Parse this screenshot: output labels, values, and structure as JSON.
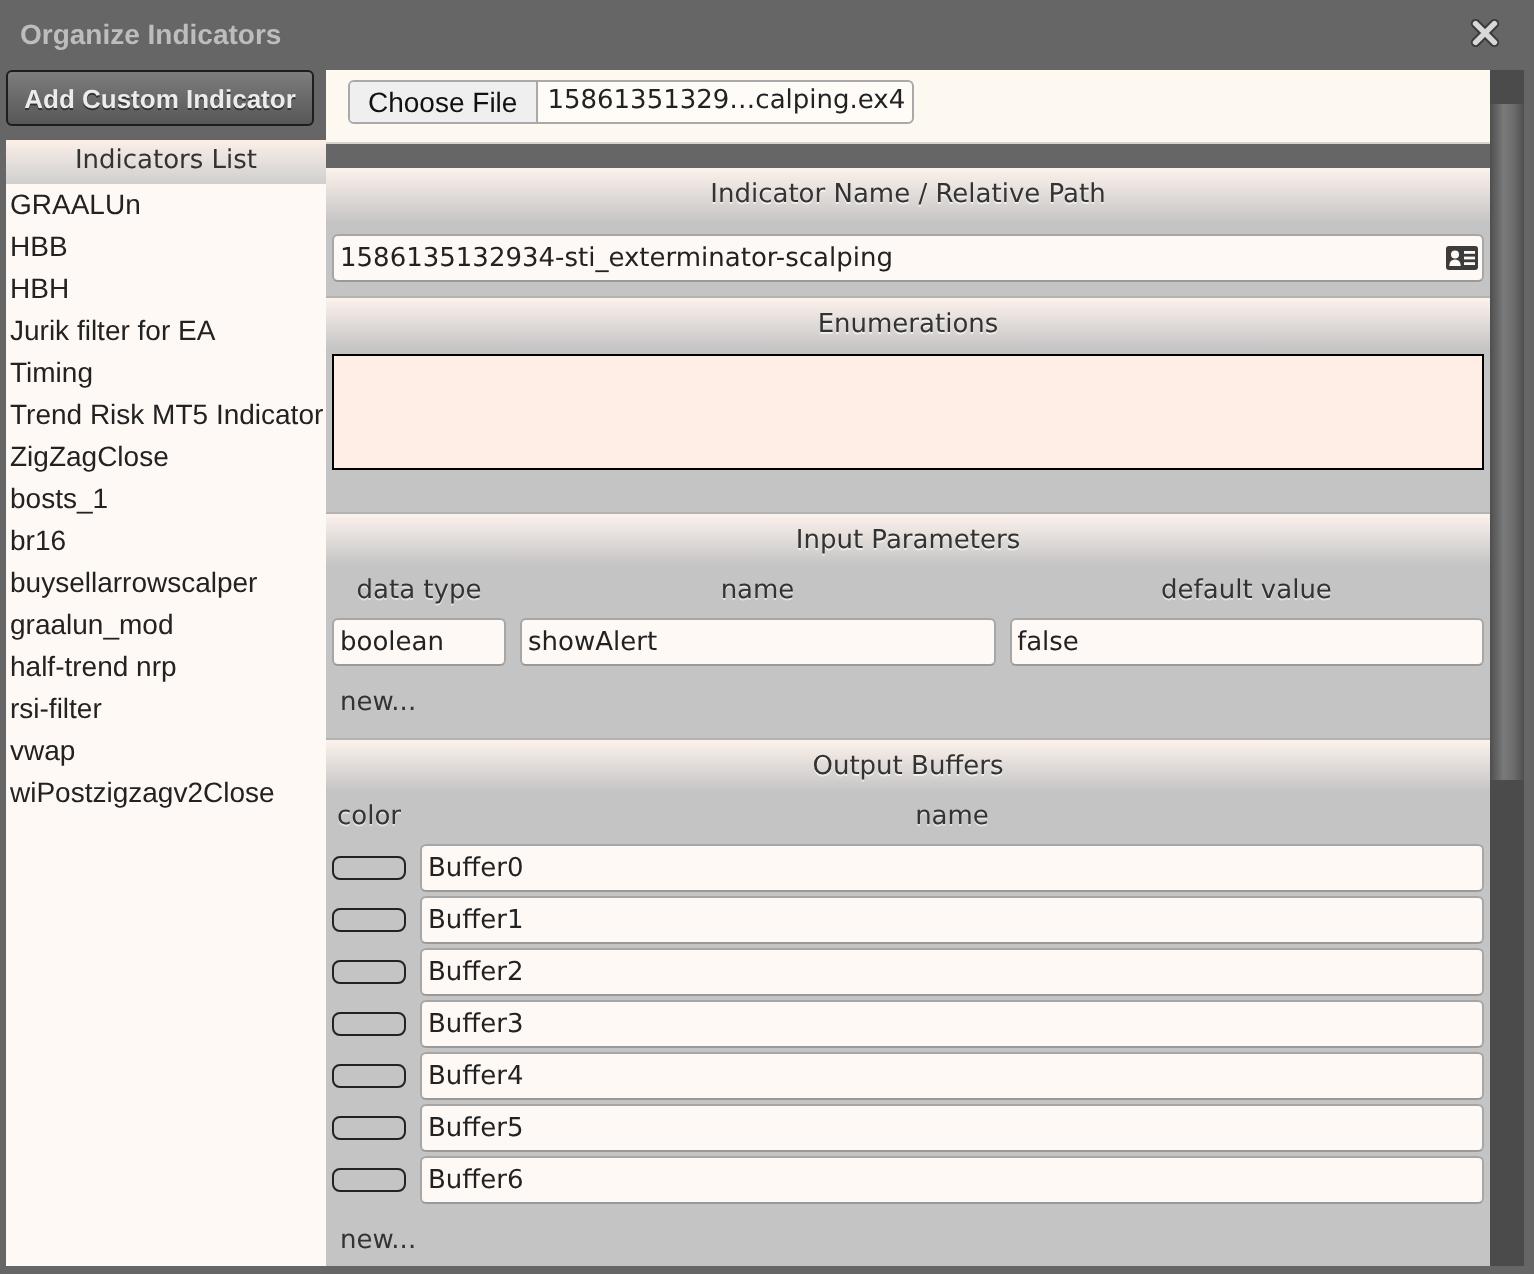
{
  "window": {
    "title": "Organize Indicators"
  },
  "add_button": {
    "label": "Add Custom Indicator"
  },
  "indicators_list": {
    "title": "Indicators List",
    "items": [
      {
        "label": "GRAALUn",
        "selected": false
      },
      {
        "label": "HBB",
        "selected": false
      },
      {
        "label": "HBH",
        "selected": false
      },
      {
        "label": "Jurik filter for EA",
        "selected": false
      },
      {
        "label": "Timing",
        "selected": false
      },
      {
        "label": "Trend Risk MT5 Indicator",
        "selected": false
      },
      {
        "label": "ZigZagClose",
        "selected": false
      },
      {
        "label": "bosts_1",
        "selected": false
      },
      {
        "label": "br16",
        "selected": false
      },
      {
        "label": "buysellarrowscalper",
        "selected": false
      },
      {
        "label": "graalun_mod",
        "selected": false
      },
      {
        "label": "half-trend nrp",
        "selected": false
      },
      {
        "label": "rsi-filter",
        "selected": false
      },
      {
        "label": "vwap",
        "selected": false
      },
      {
        "label": "wiPostzigzagv2Close",
        "selected": false
      }
    ]
  },
  "file_picker": {
    "button": "Choose File",
    "file_name": "15861351329…calping.ex4"
  },
  "indicator_name": {
    "title": "Indicator Name / Relative Path",
    "value": "1586135132934-sti_exterminator-scalping"
  },
  "enumerations": {
    "title": "Enumerations"
  },
  "input_parameters": {
    "title": "Input Parameters",
    "columns": [
      "data type",
      "name",
      "default value"
    ],
    "rows": [
      {
        "data_type": "boolean",
        "name": "showAlert",
        "default_value": "false"
      }
    ],
    "new_link": "new..."
  },
  "output_buffers": {
    "title": "Output Buffers",
    "columns": [
      "color",
      "name"
    ],
    "rows": [
      {
        "name": "Buffer0"
      },
      {
        "name": "Buffer1"
      },
      {
        "name": "Buffer2"
      },
      {
        "name": "Buffer3"
      },
      {
        "name": "Buffer4"
      },
      {
        "name": "Buffer5"
      },
      {
        "name": "Buffer6"
      }
    ],
    "new_link": "new..."
  }
}
